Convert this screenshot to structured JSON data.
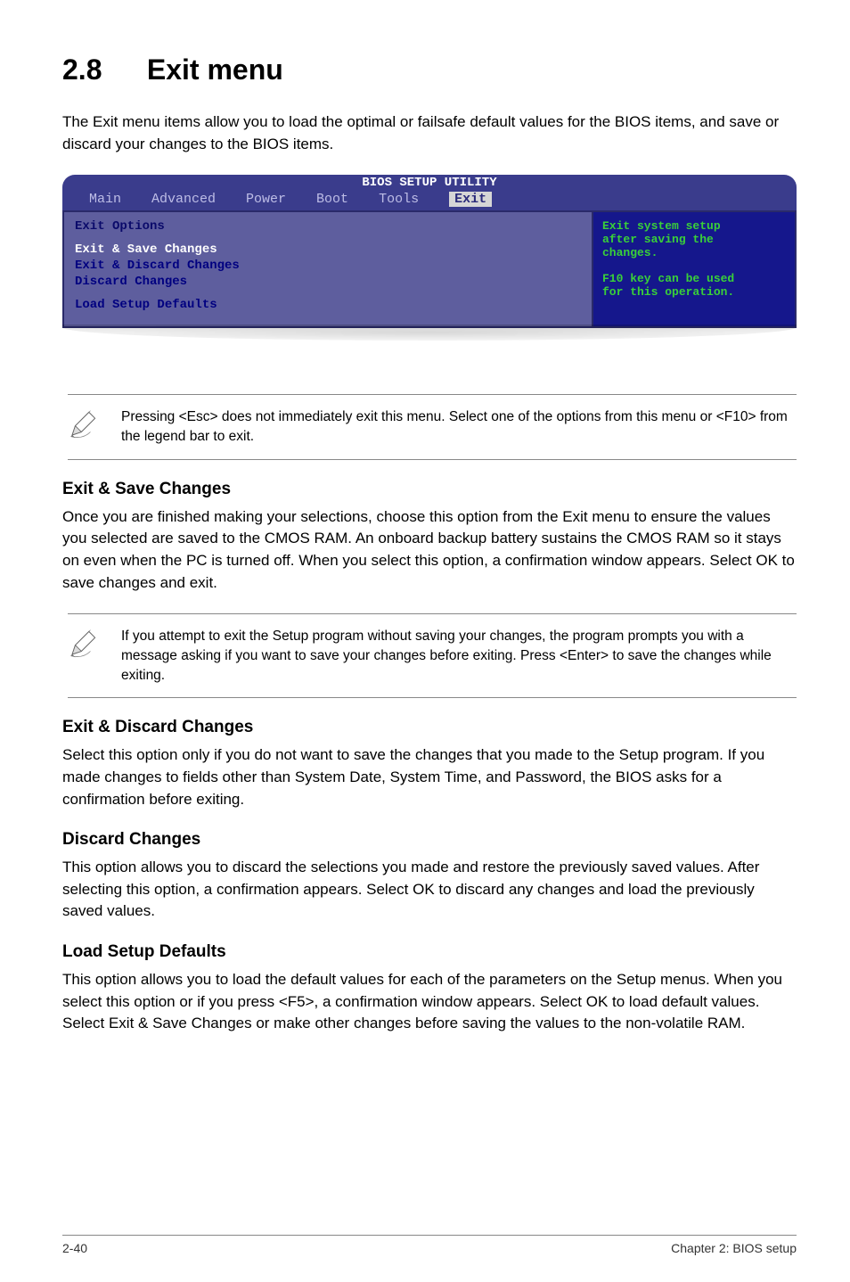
{
  "section": {
    "number": "2.8",
    "title": "Exit menu"
  },
  "intro": "The Exit menu items allow you to load the optimal or failsafe default values for the BIOS items, and save or discard your changes to the BIOS items.",
  "bios": {
    "header": "BIOS SETUP UTILITY",
    "tabs": [
      "Main",
      "Advanced",
      "Power",
      "Boot",
      "Tools",
      "Exit"
    ],
    "active_tab": "Exit",
    "left": {
      "title": "Exit Options",
      "items": [
        "Exit & Save Changes",
        "Exit & Discard Changes",
        "Discard Changes"
      ],
      "item_lsd": "Load Setup Defaults"
    },
    "right": {
      "l1": "Exit system setup",
      "l2": "after saving the",
      "l3": "changes.",
      "l4": "F10 key can be used",
      "l5": "for this operation."
    }
  },
  "note1": "Pressing <Esc> does not immediately exit this menu. Select one of the options from this menu or <F10> from the legend bar to exit.",
  "h_esc": "Exit & Save Changes",
  "p_esc": "Once you are finished making your selections, choose this option from the Exit menu to ensure the values you selected are saved to the CMOS RAM. An onboard backup battery sustains the CMOS RAM so it stays on even when the PC is turned off. When you select this option, a confirmation window appears. Select OK to save changes and exit.",
  "note2": " If you attempt to exit the Setup program without saving your changes, the program prompts you with a message asking if you want to save your changes before exiting. Press <Enter>  to save the  changes while exiting.",
  "h_edc": "Exit & Discard Changes",
  "p_edc": "Select this option only if you do not want to save the changes that you  made to the Setup program. If you made changes to fields other than System Date, System Time, and Password, the BIOS asks for a confirmation before exiting.",
  "h_dc": "Discard Changes",
  "p_dc": "This option allows you to discard the selections you made and restore the previously saved values. After selecting this option, a confirmation appears. Select OK to discard any changes and load the previously saved values.",
  "h_lsd": "Load Setup Defaults",
  "p_lsd": "This option allows you to load the default values for each of the parameters on the Setup menus. When you select this option or if you press <F5>, a confirmation window appears. Select OK to load default values. Select Exit & Save Changes or make other changes before saving the values to the non-volatile RAM.",
  "footer": {
    "left": "2-40",
    "right": "Chapter 2: BIOS setup"
  }
}
